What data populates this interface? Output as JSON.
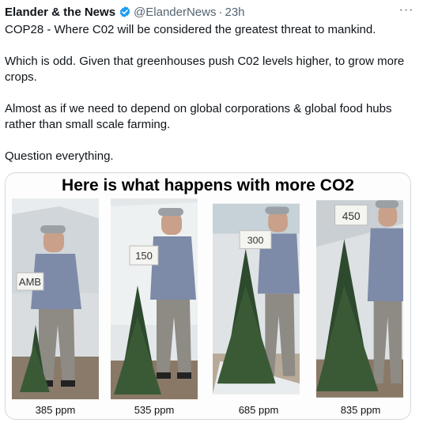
{
  "tweet": {
    "author_name": "Elander & the News",
    "handle": "@ElanderNews",
    "separator": "·",
    "time": "23h",
    "more_label": "···",
    "paragraphs": [
      "COP28 - Where C02 will be considered the greatest threat to mankind.",
      "Which is odd. Given that greenhouses push C02 levels higher, to grow more crops.",
      "Almost as if we need to depend on global corporations & global food hubs rather than small scale farming.",
      "Question everything."
    ]
  },
  "media": {
    "title": "Here is what happens with more CO2",
    "panels": [
      {
        "sign": "AMB",
        "caption": "385 ppm"
      },
      {
        "sign": "150",
        "caption": "535 ppm"
      },
      {
        "sign": "300",
        "caption": "685 ppm"
      },
      {
        "sign": "450",
        "caption": "835 ppm"
      }
    ]
  },
  "colors": {
    "text": "#0f1419",
    "secondary": "#536471",
    "verified": "#1d9bf0",
    "border": "#cfd9de"
  }
}
